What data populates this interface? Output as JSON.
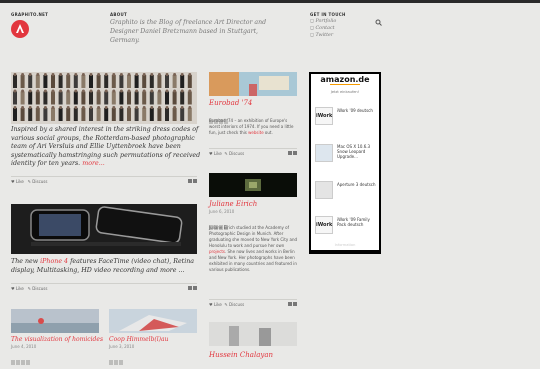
{
  "site": {
    "name": "GRAPHITO.NET"
  },
  "about": {
    "heading": "ABOUT",
    "text": "Graphito is the Blog of freelance Art Director and Designer Daniel Bretzmann based in Stuttgart, Germany."
  },
  "contact": {
    "heading": "GET IN TOUCH",
    "links": [
      "Portfolio",
      "Contact",
      "Twitter"
    ]
  },
  "post1": {
    "text": "Inspired by a shared interest in the striking dress codes of various social groups, the Rotterdam-based photographic team of Ari Versluis and Ellie Uyttenbroek have been systematically hamstringing such permutations of received identity for ten years.",
    "more": "more..."
  },
  "post2": {
    "text_lead": "The new ",
    "link": "iPhone 4",
    "text_rest": " features FaceTime (video chat), Retina display, Multitasking, HD video recording and more ..."
  },
  "post3": {
    "title": "Eurobad '74",
    "text_lead": "Eurobad '74 – an exhibition of Europe's worst interiors of 1974. If you need a little fun, just check this ",
    "link": "website",
    "text_rest": " out."
  },
  "post4": {
    "title": "Juliane Eirich",
    "date": "June 6, 2010",
    "text_lead": "Juliane Eirich studied at the Academy of Photographic Design in Munich. After graduating she moved to New York City and Honolulu to work and pursue her own ",
    "link": "projects",
    "text_rest": ". She now lives and works in Berlin and New York. Her photographs have been exhibited in many countries and featured in various publications."
  },
  "post5": {
    "title": "The visualization of homicides",
    "date": "June 4, 2010"
  },
  "post6": {
    "title": "Coop Himmelb(l)au",
    "date": "June 3, 2010"
  },
  "post7": {
    "title": "Hussein Chalayan"
  },
  "actions": {
    "like": "Like",
    "discuss": "Discuss"
  },
  "amazon": {
    "logo": "amazon.de",
    "cta": "Jetzt einkaufen!",
    "items": [
      {
        "title": "iWork '09 deutsch",
        "icon_text": "iWork"
      },
      {
        "title": "Mac OS X 10.6.3 Snow Leopard Upgrade...",
        "icon_text": ""
      },
      {
        "title": "Aperture 3 deutsch",
        "icon_text": ""
      },
      {
        "title": "iWork '09 Family Pack deutsch",
        "icon_text": "iWork"
      }
    ],
    "footer": "Information"
  },
  "colors": {
    "accent": "#e2363e",
    "background": "#e9e9e7"
  }
}
